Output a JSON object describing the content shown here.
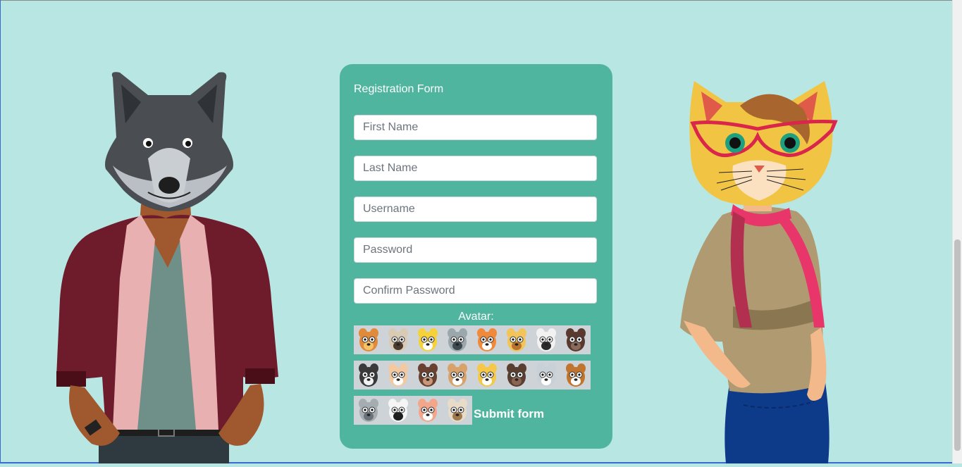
{
  "form": {
    "title": "Registration Form",
    "fields": {
      "first_name": {
        "placeholder": "First Name",
        "value": ""
      },
      "last_name": {
        "placeholder": "Last Name",
        "value": ""
      },
      "username": {
        "placeholder": "Username",
        "value": ""
      },
      "password": {
        "placeholder": "Password",
        "value": ""
      },
      "confirm_password": {
        "placeholder": "Confirm Password",
        "value": ""
      }
    },
    "avatar_label": "Avatar:",
    "submit_label": "Submit form"
  },
  "avatars": [
    [
      "lion",
      "pug",
      "chick",
      "raccoon",
      "fox",
      "giraffe",
      "badger",
      "gorilla"
    ],
    [
      "skunk",
      "rabbit",
      "monkey",
      "deer",
      "lion-cub",
      "bear",
      "wolf",
      "dog"
    ],
    [
      "koala",
      "panda",
      "pig",
      "reindeer"
    ]
  ],
  "colors": {
    "page_background": "#b8e6e3",
    "card_background": "#4fb59f",
    "text_on_card": "#ffffff"
  }
}
